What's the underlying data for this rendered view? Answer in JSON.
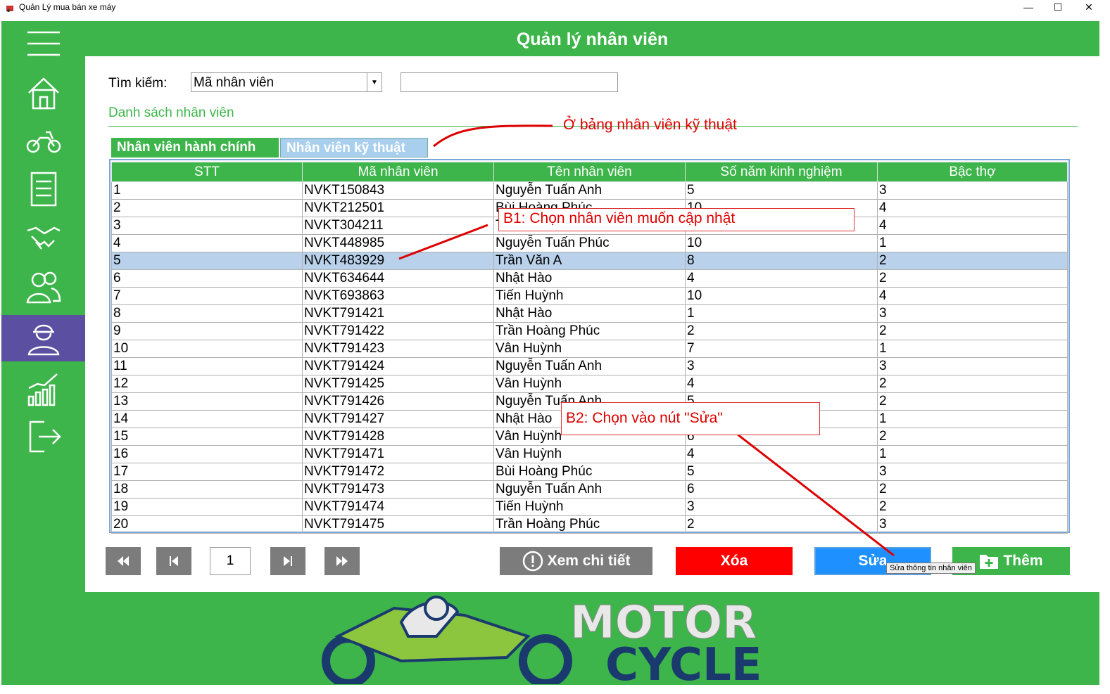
{
  "window": {
    "title": "Quản Lý mua bán xe máy",
    "minimize": "—",
    "maximize": "☐",
    "close": "✕"
  },
  "header": {
    "title": "Quản lý nhân viên"
  },
  "sidebar": {
    "items": [
      {
        "icon": "menu-icon"
      },
      {
        "icon": "home-icon"
      },
      {
        "icon": "motorcycle-icon"
      },
      {
        "icon": "invoice-icon"
      },
      {
        "icon": "handshake-icon"
      },
      {
        "icon": "users-icon"
      },
      {
        "icon": "worker-icon",
        "active": true
      },
      {
        "icon": "statistics-icon"
      },
      {
        "icon": "logout-icon"
      }
    ]
  },
  "search": {
    "label": "Tìm kiếm:",
    "field_value": "Mã nhân viên",
    "query_value": ""
  },
  "list": {
    "title": "Danh sách nhân viên",
    "tabs": [
      "Nhân viên hành chính",
      "Nhân viên kỹ thuật"
    ],
    "columns": [
      "STT",
      "Mã nhân viên",
      "Tên nhân viên",
      "Số năm kinh nghiệm",
      "Bậc thợ"
    ],
    "rows": [
      [
        "1",
        "NVKT150843",
        "Nguyễn Tuấn Anh",
        "5",
        "3"
      ],
      [
        "2",
        "NVKT212501",
        "Bùi Hoàng Phúc",
        "10",
        "4"
      ],
      [
        "3",
        "NVKT304211",
        "T",
        "",
        "4"
      ],
      [
        "4",
        "NVKT448985",
        "Nguyễn Tuấn Phúc",
        "10",
        "1"
      ],
      [
        "5",
        "NVKT483929",
        "Trần Văn A",
        "8",
        "2"
      ],
      [
        "6",
        "NVKT634644",
        "Nhật Hào",
        "4",
        "2"
      ],
      [
        "7",
        "NVKT693863",
        "Tiến Huỳnh",
        "10",
        "4"
      ],
      [
        "8",
        "NVKT791421",
        "Nhật Hào",
        "1",
        "3"
      ],
      [
        "9",
        "NVKT791422",
        "Trần Hoàng Phúc",
        "2",
        "2"
      ],
      [
        "10",
        "NVKT791423",
        "Vân Huỳnh",
        "7",
        "1"
      ],
      [
        "11",
        "NVKT791424",
        "Nguyễn Tuấn Anh",
        "3",
        "3"
      ],
      [
        "12",
        "NVKT791425",
        "Vân Huỳnh",
        "4",
        "2"
      ],
      [
        "13",
        "NVKT791426",
        "Nguyễn Tuấn Anh",
        "5",
        "2"
      ],
      [
        "14",
        "NVKT791427",
        "Nhật Hào",
        "",
        "1"
      ],
      [
        "15",
        "NVKT791428",
        "Vân Huỳnh",
        "6",
        "2"
      ],
      [
        "16",
        "NVKT791471",
        "Vân Huỳnh",
        "4",
        "1"
      ],
      [
        "17",
        "NVKT791472",
        "Bùi Hoàng Phúc",
        "5",
        "3"
      ],
      [
        "18",
        "NVKT791473",
        "Nguyễn Tuấn Anh",
        "6",
        "2"
      ],
      [
        "19",
        "NVKT791474",
        "Tiến Huỳnh",
        "3",
        "2"
      ],
      [
        "20",
        "NVKT791475",
        "Trần Hoàng Phúc",
        "2",
        "3"
      ]
    ],
    "selected_row": 5
  },
  "pager": {
    "page": "1"
  },
  "actions": {
    "detail": "Xem chi tiết",
    "delete": "Xóa",
    "edit": "Sửa",
    "add": "Thêm",
    "edit_tooltip": "Sửa thông tin nhân viên"
  },
  "annotations": {
    "tab_note": "Ở bảng nhân viên kỹ thuật",
    "step1": "B1: Chọn nhân viên muốn cập nhật",
    "step2": "B2: Chọn vào nút \"Sửa\""
  },
  "logo": {
    "line1": "MOTOR",
    "line2": "CYCLE"
  },
  "colors": {
    "primary_green": "#3db54a",
    "active_purple": "#5a4fa0",
    "delete_red": "#ff0000",
    "edit_blue": "#1e90ff",
    "annotation_red": "#dd0000"
  }
}
